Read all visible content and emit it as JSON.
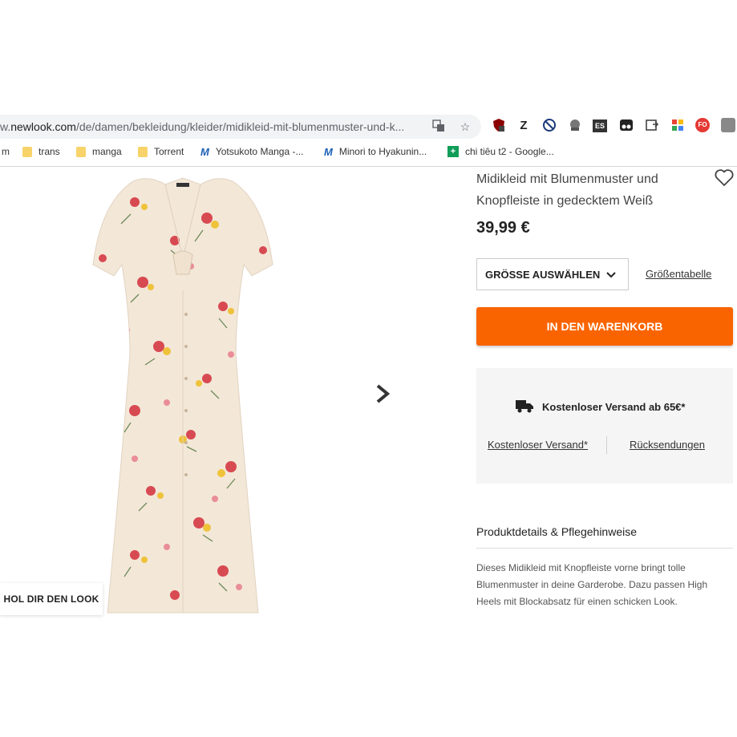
{
  "browser": {
    "url_prefix": "w.",
    "url_domain": "newlook.com",
    "url_path": "/de/damen/bekleidung/kleider/midikleid-mit-blumenmuster-und-k...",
    "extensions": [
      "ublock-icon",
      "zotero-icon",
      "block-icon",
      "spy-icon",
      "es-icon",
      "tampermonkey-icon",
      "share-icon",
      "google-icon",
      "fo-icon",
      "avatar-icon"
    ]
  },
  "bookmarks": [
    {
      "label": "m",
      "icon": "none"
    },
    {
      "label": "trans",
      "icon": "folder"
    },
    {
      "label": "manga",
      "icon": "folder"
    },
    {
      "label": "Torrent",
      "icon": "folder"
    },
    {
      "label": "Yotsukoto Manga -...",
      "icon": "m-logo"
    },
    {
      "label": "Minori to Hyakunin...",
      "icon": "m-logo"
    },
    {
      "label": "chi tiêu t2 - Google...",
      "icon": "sheets"
    }
  ],
  "product": {
    "title_line1": "Midikleid mit Blumenmuster und",
    "title_line2": "Knopfleiste in gedecktem Weiß",
    "price": "39,99 €",
    "size_select": "GRÖSSE AUSWÄHLEN",
    "size_table_link": "Größentabelle",
    "add_to_cart": "IN DEN WARENKORB",
    "shipping_info": "Kostenloser Versand ab 65€*",
    "shipping_link": "Kostenloser Versand*",
    "returns_link": "Rücksendungen",
    "details_heading": "Produktdetails & Pflegehinweise",
    "details_text": "Dieses Midikleid mit Knopfleiste vorne bringt tolle Blumenmuster in deine Garderobe. Dazu passen High Heels mit Blockabsatz für einen schicken Look.",
    "look_button": "HOL DIR DEN LOOK"
  },
  "colors": {
    "accent": "#fa6400",
    "panel": "#f5f5f5"
  }
}
